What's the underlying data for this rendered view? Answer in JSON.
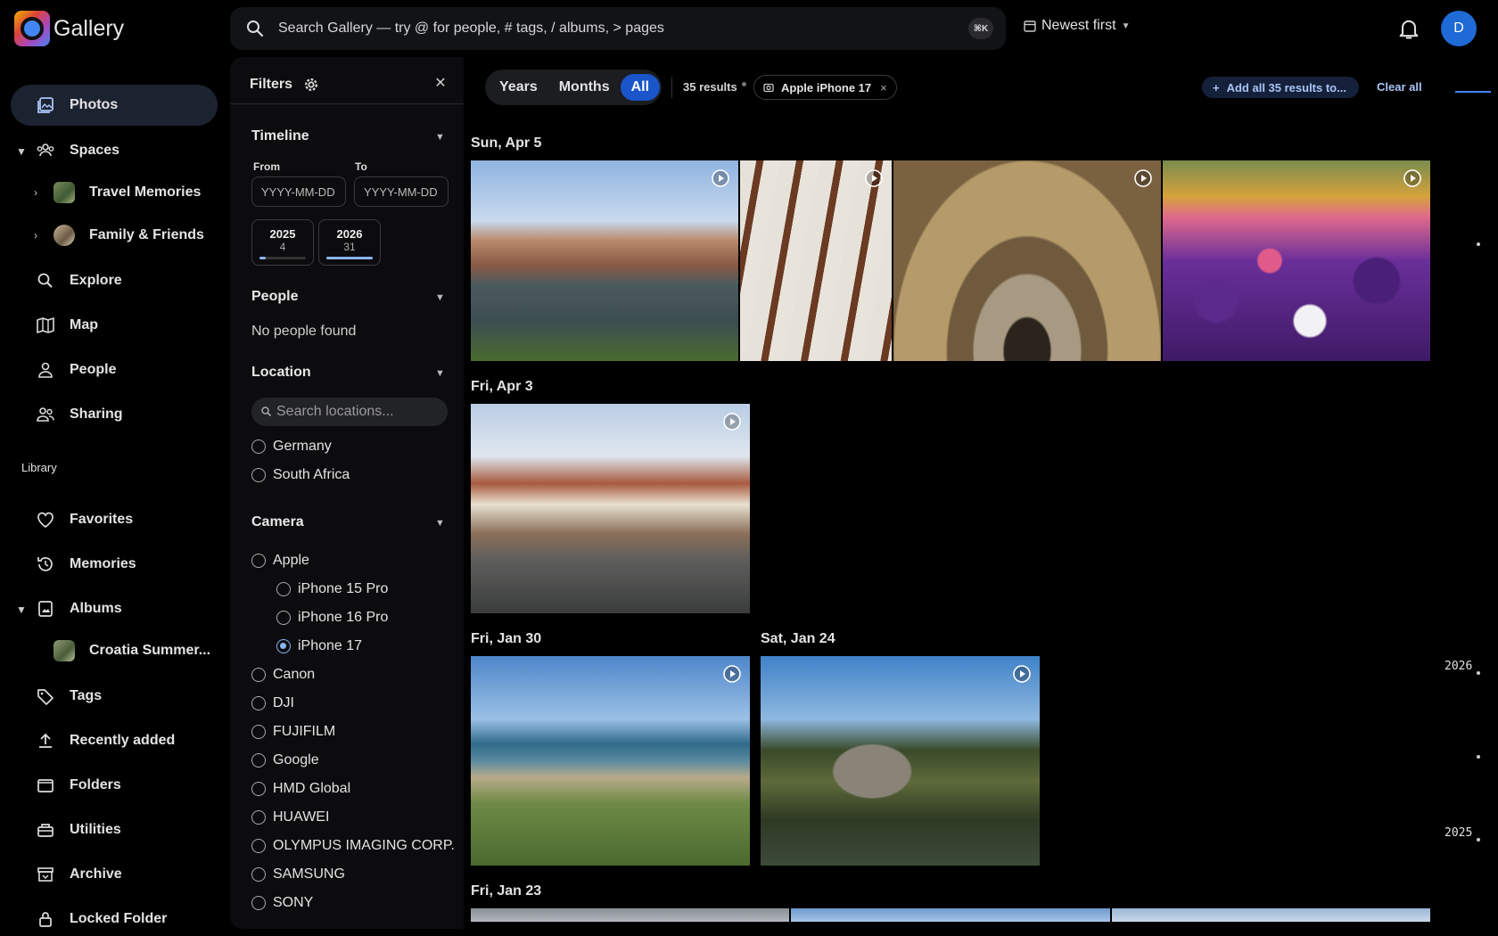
{
  "app": {
    "name": "Gallery"
  },
  "search": {
    "placeholder": "Search Gallery — try @ for people, # tags, / albums, > pages",
    "shortcut": "⌘K"
  },
  "sort": {
    "label": "Newest first"
  },
  "user": {
    "initial": "D"
  },
  "nav": {
    "photos": "Photos",
    "spaces": "Spaces",
    "spaces_children": [
      "Travel Memories",
      "Family & Friends"
    ],
    "explore": "Explore",
    "map": "Map",
    "people": "People",
    "sharing": "Sharing",
    "library_heading": "Library",
    "favorites": "Favorites",
    "memories": "Memories",
    "albums": "Albums",
    "albums_children": [
      "Croatia Summer..."
    ],
    "tags": "Tags",
    "recently_added": "Recently added",
    "folders": "Folders",
    "utilities": "Utilities",
    "archive": "Archive",
    "locked_folder": "Locked Folder"
  },
  "filters": {
    "title": "Filters",
    "timeline": {
      "title": "Timeline",
      "from_label": "From",
      "to_label": "To",
      "from_placeholder": "YYYY-MM-DD",
      "to_placeholder": "YYYY-MM-DD",
      "years": [
        {
          "year": "2025",
          "count": "4",
          "share": 0.13
        },
        {
          "year": "2026",
          "count": "31",
          "share": 1.0
        }
      ]
    },
    "people": {
      "title": "People",
      "empty": "No people found"
    },
    "location": {
      "title": "Location",
      "search_placeholder": "Search locations...",
      "options": [
        "Germany",
        "South Africa"
      ]
    },
    "camera": {
      "title": "Camera",
      "options": [
        {
          "label": "Apple",
          "selected": false,
          "level": 0
        },
        {
          "label": "iPhone 15 Pro",
          "selected": false,
          "level": 1
        },
        {
          "label": "iPhone 16 Pro",
          "selected": false,
          "level": 1
        },
        {
          "label": "iPhone 17",
          "selected": true,
          "level": 1
        },
        {
          "label": "Canon",
          "selected": false,
          "level": 0
        },
        {
          "label": "DJI",
          "selected": false,
          "level": 0
        },
        {
          "label": "FUJIFILM",
          "selected": false,
          "level": 0
        },
        {
          "label": "Google",
          "selected": false,
          "level": 0
        },
        {
          "label": "HMD Global",
          "selected": false,
          "level": 0
        },
        {
          "label": "HUAWEI",
          "selected": false,
          "level": 0
        },
        {
          "label": "OLYMPUS IMAGING CORP.",
          "selected": false,
          "level": 0
        },
        {
          "label": "SAMSUNG",
          "selected": false,
          "level": 0
        },
        {
          "label": "SONY",
          "selected": false,
          "level": 0
        }
      ]
    }
  },
  "toolbar": {
    "view_years": "Years",
    "view_months": "Months",
    "view_all": "All",
    "results": "35 results",
    "chip_label": "Apple iPhone 17",
    "chip_remove": "×",
    "add_all": "Add all 35 results to...",
    "clear_all": "Clear all"
  },
  "groups": [
    {
      "date": "Sun, Apr 5"
    },
    {
      "date": "Fri, Apr 3"
    },
    {
      "date": "Fri, Jan 30"
    },
    {
      "date": "Sat, Jan 24"
    },
    {
      "date": "Fri, Jan 23"
    }
  ],
  "scrubber": {
    "years": [
      "2026",
      "2025"
    ]
  },
  "colors": {
    "accent": "#1a56c9",
    "link": "#a8c4f5",
    "active_nav": "#1c2330"
  }
}
